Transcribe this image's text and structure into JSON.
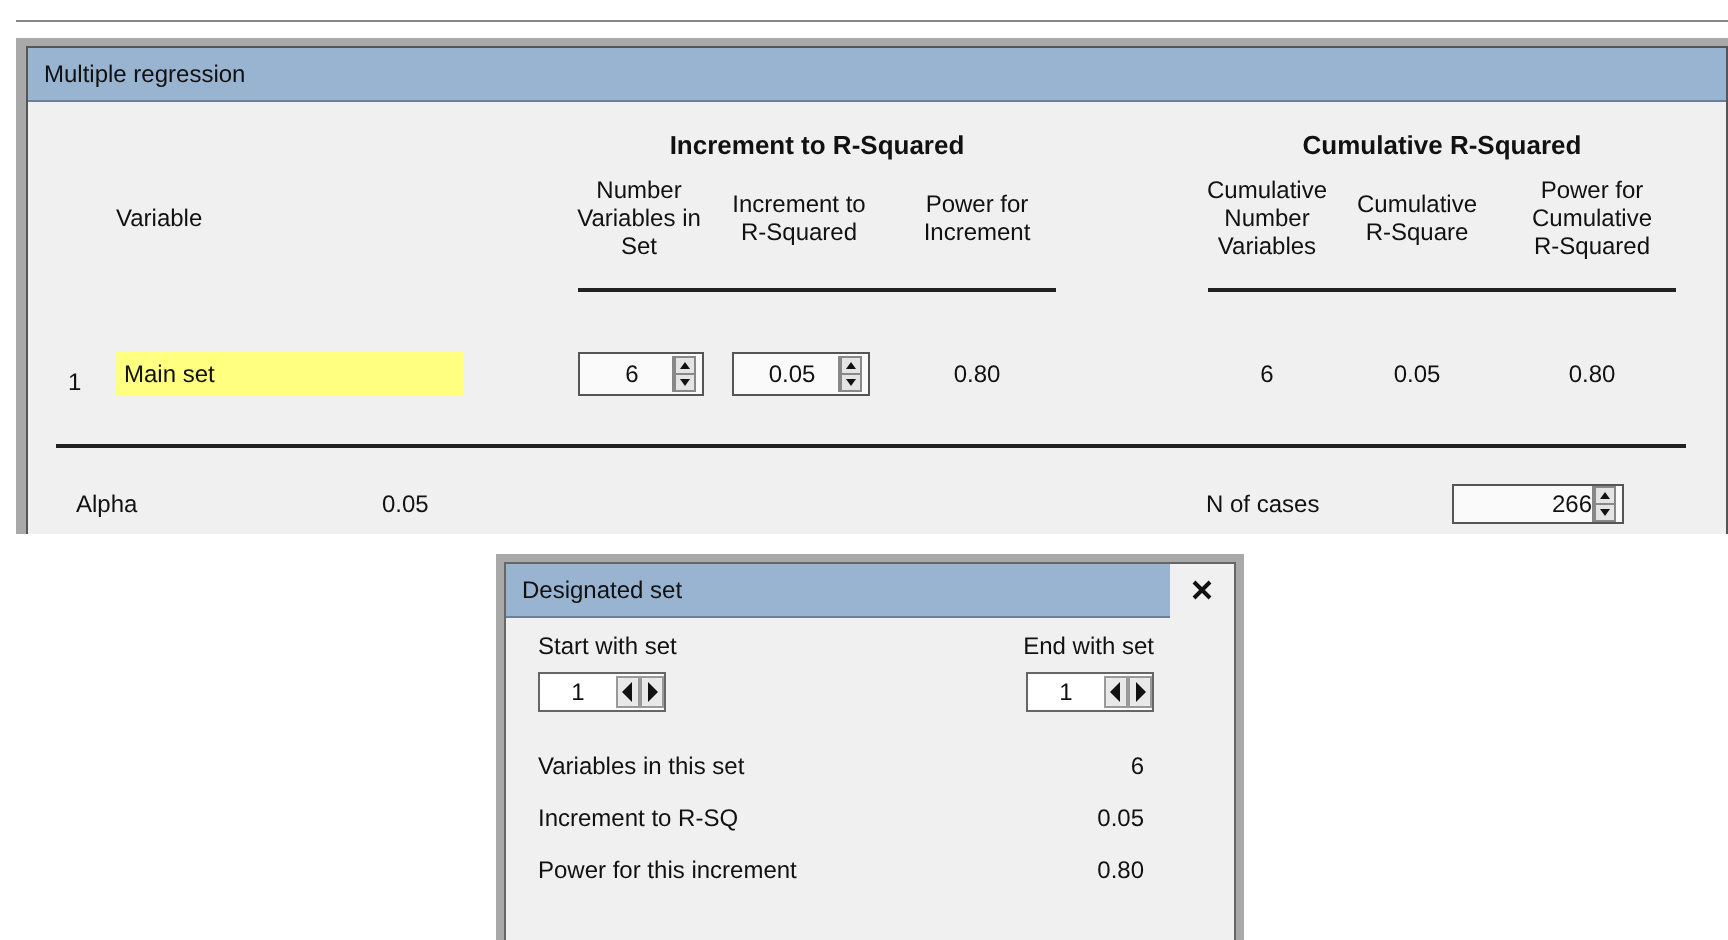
{
  "window": {
    "title": "Multiple regression"
  },
  "groups": [
    "Increment to R-Squared",
    "Cumulative R-Squared"
  ],
  "columns": [
    "Variable",
    "Number\nVariables in\nSet",
    "Increment to\nR-Squared",
    "Power for\nIncrement",
    "Cumulative\nNumber\nVariables",
    "Cumulative\nR-Square",
    "Power for\nCumulative\nR-Squared"
  ],
  "rows": [
    {
      "index": "1",
      "name": "Main set",
      "count": "6",
      "increment": "0.05",
      "power": "0.80",
      "cum_count": "6",
      "cum_rsq": "0.05",
      "cum_power": "0.80"
    }
  ],
  "footer": {
    "alpha_label": "Alpha",
    "alpha_value": "0.05",
    "cases_label": "N of cases",
    "cases_value": "266"
  },
  "dialog": {
    "title": "Designated set",
    "start_label": "Start with set",
    "start_value": "1",
    "end_label": "End with set",
    "end_value": "1",
    "stats": [
      {
        "label": "Variables in this set",
        "value": "6"
      },
      {
        "label": "Increment to R-SQ",
        "value": "0.05"
      },
      {
        "label": "Power for this increment",
        "value": "0.80"
      }
    ]
  }
}
